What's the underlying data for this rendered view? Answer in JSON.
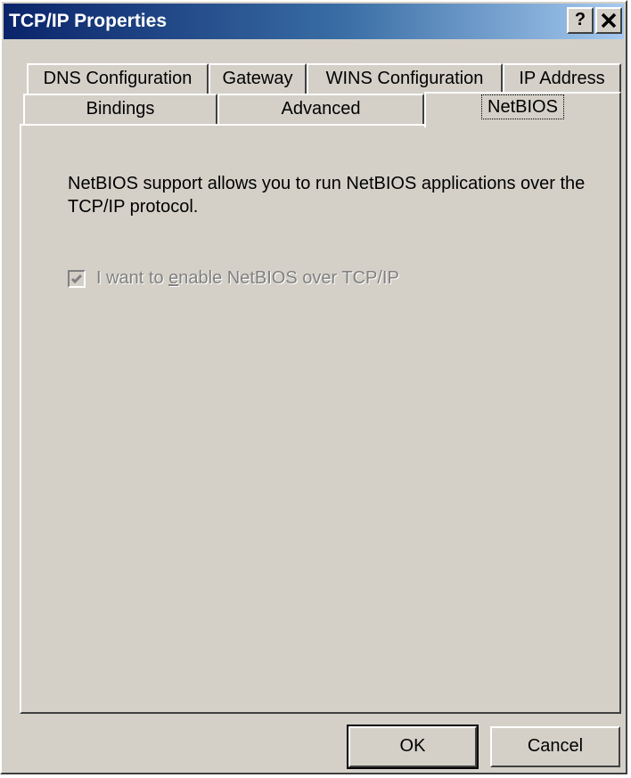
{
  "window": {
    "title": "TCP/IP Properties",
    "help_label": "?",
    "close_label": "✕",
    "colors": {
      "titlebar_start": "#0a246a",
      "titlebar_end": "#a6caf0",
      "face": "#d4d0c8",
      "disabled_text": "#808080"
    }
  },
  "tabs": {
    "back_row": [
      {
        "label": "DNS Configuration"
      },
      {
        "label": "Gateway"
      },
      {
        "label": "WINS Configuration"
      },
      {
        "label": "IP Address"
      }
    ],
    "front_row": [
      {
        "label": "Bindings"
      },
      {
        "label": "Advanced"
      },
      {
        "label": "NetBIOS",
        "active": true
      }
    ]
  },
  "netbios": {
    "description": "NetBIOS support allows you to run NetBIOS applications over the TCP/IP protocol.",
    "checkbox": {
      "label_before": "I want to ",
      "label_accel": "e",
      "label_after": "nable NetBIOS over TCP/IP",
      "checked": true,
      "enabled": false
    }
  },
  "buttons": {
    "ok_label": "OK",
    "cancel_label": "Cancel"
  }
}
